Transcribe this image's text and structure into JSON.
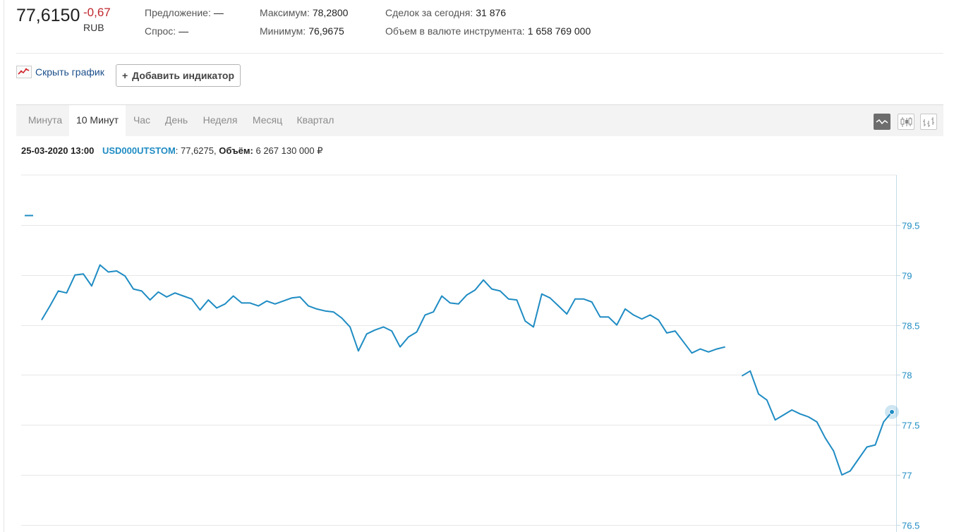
{
  "quote": {
    "price": "77,6150",
    "change": "-0,67",
    "currency": "RUB",
    "offer_label": "Предложение:",
    "offer_value": "—",
    "bid_label": "Спрос:",
    "bid_value": "—",
    "max_label": "Максимум:",
    "max_value": "78,2800",
    "min_label": "Минимум:",
    "min_value": "76,9675",
    "deals_label": "Сделок за сегодня:",
    "deals_value": "31 876",
    "volume_label": "Объем в валюте инструмента:",
    "volume_value": "1 658 769 000"
  },
  "toolbar": {
    "hide_chart_label": "Скрыть график",
    "add_indicator_plus": "+",
    "add_indicator_label": "Добавить индикатор"
  },
  "tabs": [
    "Минута",
    "10 Минут",
    "Час",
    "День",
    "Неделя",
    "Месяц",
    "Квартал"
  ],
  "active_tab": "10 Минут",
  "chart_types": [
    "line-chart-icon",
    "candlestick-icon",
    "ohlc-bars-icon"
  ],
  "info": {
    "datetime": "25-03-2020 13:00",
    "ticker": "USD000UTSTOM",
    "price": ": 77,6275,",
    "volume_label": "Объём:",
    "volume_value": "6 267 130 000 ₽"
  },
  "colors": {
    "line": "#1f8cc3",
    "change": "#c1272d",
    "grid": "#e7e7e7"
  },
  "chart_data": {
    "type": "line",
    "ylim": [
      76.5,
      80.0
    ],
    "yticks": [
      "79.5",
      "79",
      "78.5",
      "78",
      "77.5",
      "77",
      "76.5"
    ],
    "ytick_values": [
      79.5,
      79,
      78.5,
      78,
      77.5,
      77,
      76.5
    ],
    "series": [
      {
        "segments": [
          [
            78.55,
            78.69,
            78.84,
            78.82,
            79.0,
            79.01,
            78.89,
            79.1,
            79.03,
            79.04,
            78.99,
            78.86,
            78.84,
            78.75,
            78.83,
            78.78,
            78.82,
            78.79,
            78.76,
            78.65,
            78.75,
            78.67,
            78.71,
            78.79,
            78.72,
            78.72,
            78.69,
            78.74,
            78.71,
            78.74,
            78.77,
            78.78,
            78.69,
            78.66,
            78.64,
            78.63,
            78.57,
            78.48,
            78.24,
            78.41,
            78.45,
            78.48,
            78.44,
            78.28,
            78.38,
            78.43,
            78.6,
            78.63,
            78.79,
            78.72,
            78.71,
            78.8,
            78.85,
            78.95,
            78.86,
            78.84,
            78.76,
            78.75,
            78.54,
            78.48,
            78.81,
            78.77,
            78.69,
            78.61,
            78.76,
            78.76,
            78.73,
            78.58,
            78.58,
            78.5,
            78.66,
            78.6,
            78.56,
            78.6,
            78.55,
            78.42,
            78.44,
            78.33,
            78.22,
            78.26,
            78.23,
            78.26,
            78.28
          ],
          [
            77.99,
            78.04,
            77.81,
            77.75,
            77.55,
            77.6,
            77.65,
            77.61,
            77.58,
            77.53,
            77.37,
            77.24,
            77.0,
            77.04,
            77.16,
            77.28,
            77.3,
            77.53,
            77.63
          ]
        ]
      }
    ]
  }
}
